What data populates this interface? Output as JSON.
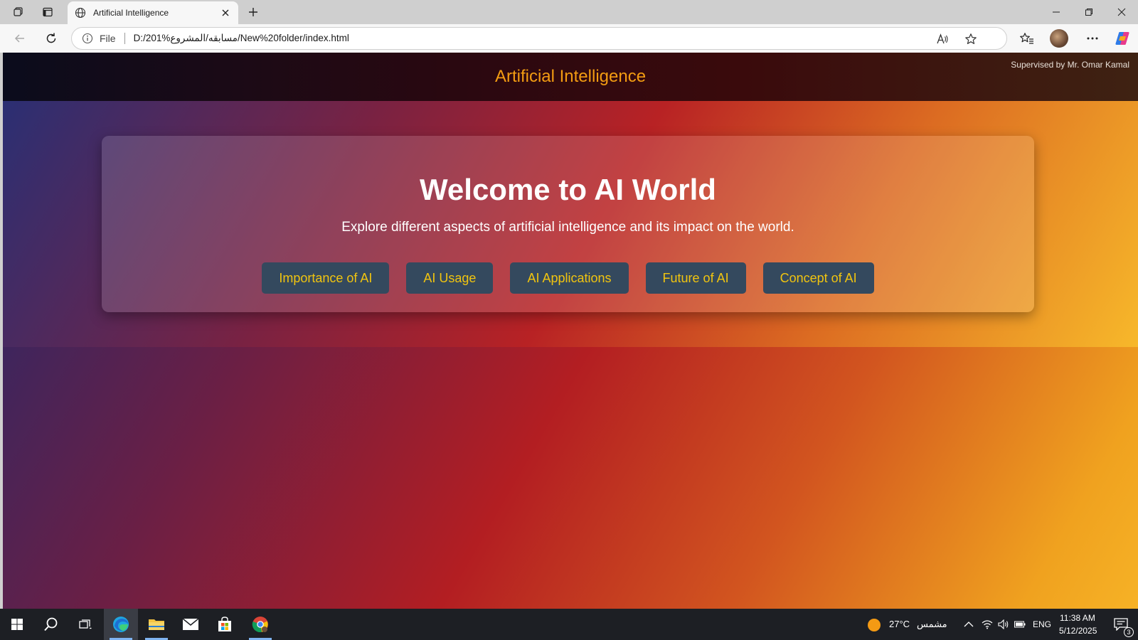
{
  "browser": {
    "tab_title": "Artificial Intelligence",
    "address_prefix": "File",
    "url": "D:/201%مسابقه/المشروع/New%20folder/index.html"
  },
  "site": {
    "title": "Artificial Intelligence",
    "supervisor": "Supervised by Mr. Omar Kamal"
  },
  "hero": {
    "heading": "Welcome to AI World",
    "subtitle": "Explore different aspects of artificial intelligence and its impact on the world.",
    "buttons": [
      {
        "label": "Importance of AI"
      },
      {
        "label": "AI Usage"
      },
      {
        "label": "AI Applications"
      },
      {
        "label": "Future of AI"
      },
      {
        "label": "Concept of AI"
      }
    ]
  },
  "taskbar": {
    "weather_temp": "27°C",
    "weather_text": "مشمس",
    "language": "ENG",
    "time": "11:38 AM",
    "date": "5/12/2025",
    "notification_count": "3"
  },
  "colors": {
    "accent": "#f39c12",
    "button_bg": "#34495e",
    "button_text": "#f1c40f"
  }
}
